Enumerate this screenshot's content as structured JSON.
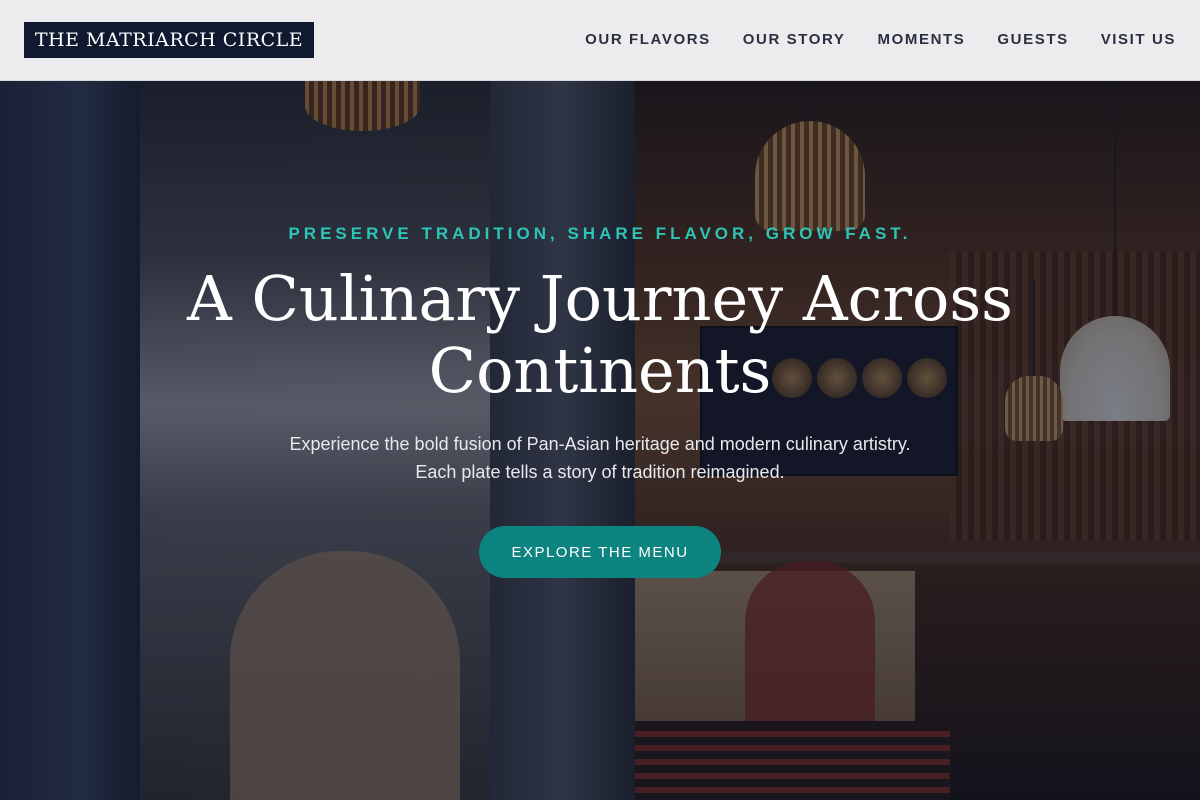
{
  "header": {
    "logo": "THE MATRIARCH CIRCLE",
    "nav": [
      {
        "label": "OUR FLAVORS"
      },
      {
        "label": "OUR STORY"
      },
      {
        "label": "MOMENTS"
      },
      {
        "label": "GUESTS"
      },
      {
        "label": "VISIT US"
      }
    ]
  },
  "hero": {
    "tagline": "PRESERVE TRADITION, SHARE FLAVOR, GROW FAST.",
    "title": "A Culinary Journey Across Continents",
    "subtitle_line1": "Experience the bold fusion of Pan-Asian heritage and modern culinary artistry.",
    "subtitle_line2": "Each plate tells a story of tradition reimagined.",
    "cta_label": "EXPLORE THE MENU"
  },
  "colors": {
    "accent": "#2ec4b6",
    "button": "#0e8480",
    "logo_bg": "#0f1a30"
  }
}
